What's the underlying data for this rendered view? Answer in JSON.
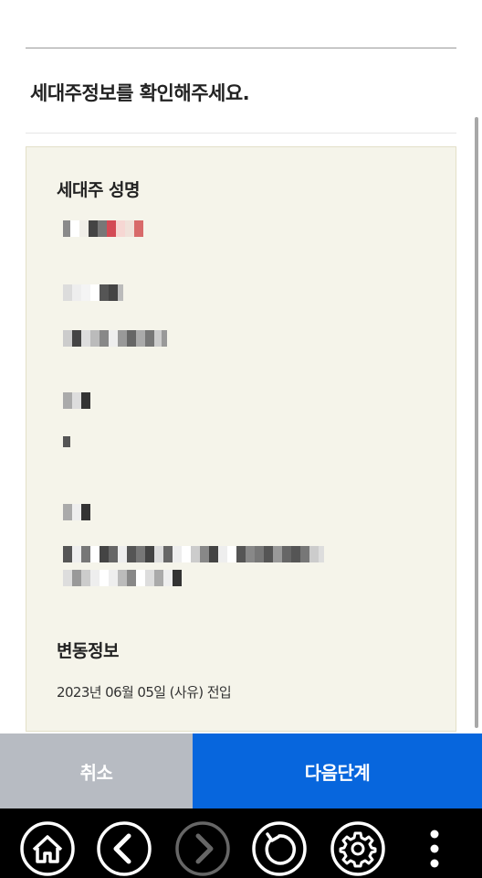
{
  "header": {
    "title": "세대주정보를 확인해주세요."
  },
  "panel": {
    "head_label": "세대주 성명",
    "change_label": "변동정보",
    "change_text": "2023년 06월 05일 (사유) 전입"
  },
  "buttons": {
    "cancel_label": "취소",
    "next_label": "다음단계"
  },
  "colors": {
    "panel_bg": "#f5f4ea",
    "cancel_bg": "#b7bbc2",
    "next_bg": "#0766dd",
    "nav_bg": "#000000"
  },
  "nav": {
    "icons": [
      "home-icon",
      "back-icon",
      "forward-icon",
      "refresh-icon",
      "settings-icon",
      "more-icon"
    ]
  }
}
